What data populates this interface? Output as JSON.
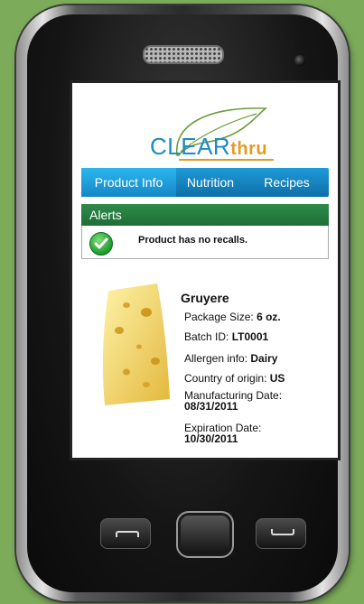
{
  "brand": {
    "logo_main": "CLEAR",
    "logo_accent": "thru"
  },
  "tabs": [
    {
      "label": "Product Info",
      "active": true
    },
    {
      "label": "Nutrition",
      "active": false
    },
    {
      "label": "Recipes",
      "active": false
    }
  ],
  "alerts": {
    "title": "Alerts",
    "message": "Product has no recalls.",
    "status_icon": "check-circle-icon",
    "status_color": "#1f9a2c"
  },
  "product": {
    "name": "Gruyere",
    "image_icon": "cheese-wedge-image",
    "package_size_label": "Package Size:",
    "package_size_value": "6 oz.",
    "batch_label": "Batch ID:",
    "batch_value": "LT0001",
    "allergen_label": "Allergen info:",
    "allergen_value": "Dairy",
    "origin_label": "Country of origin:",
    "origin_value": "US",
    "mfg_label": "Manufacturing Date:",
    "mfg_value": "08/31/2011",
    "exp_label": "Expiration Date:",
    "exp_value": "10/30/2011"
  },
  "colors": {
    "tab_blue": "#1d9ad8",
    "alert_green": "#2e8b4a",
    "logo_blue": "#1e8bc3",
    "logo_orange": "#e59b24",
    "background": "#7cac5a"
  }
}
